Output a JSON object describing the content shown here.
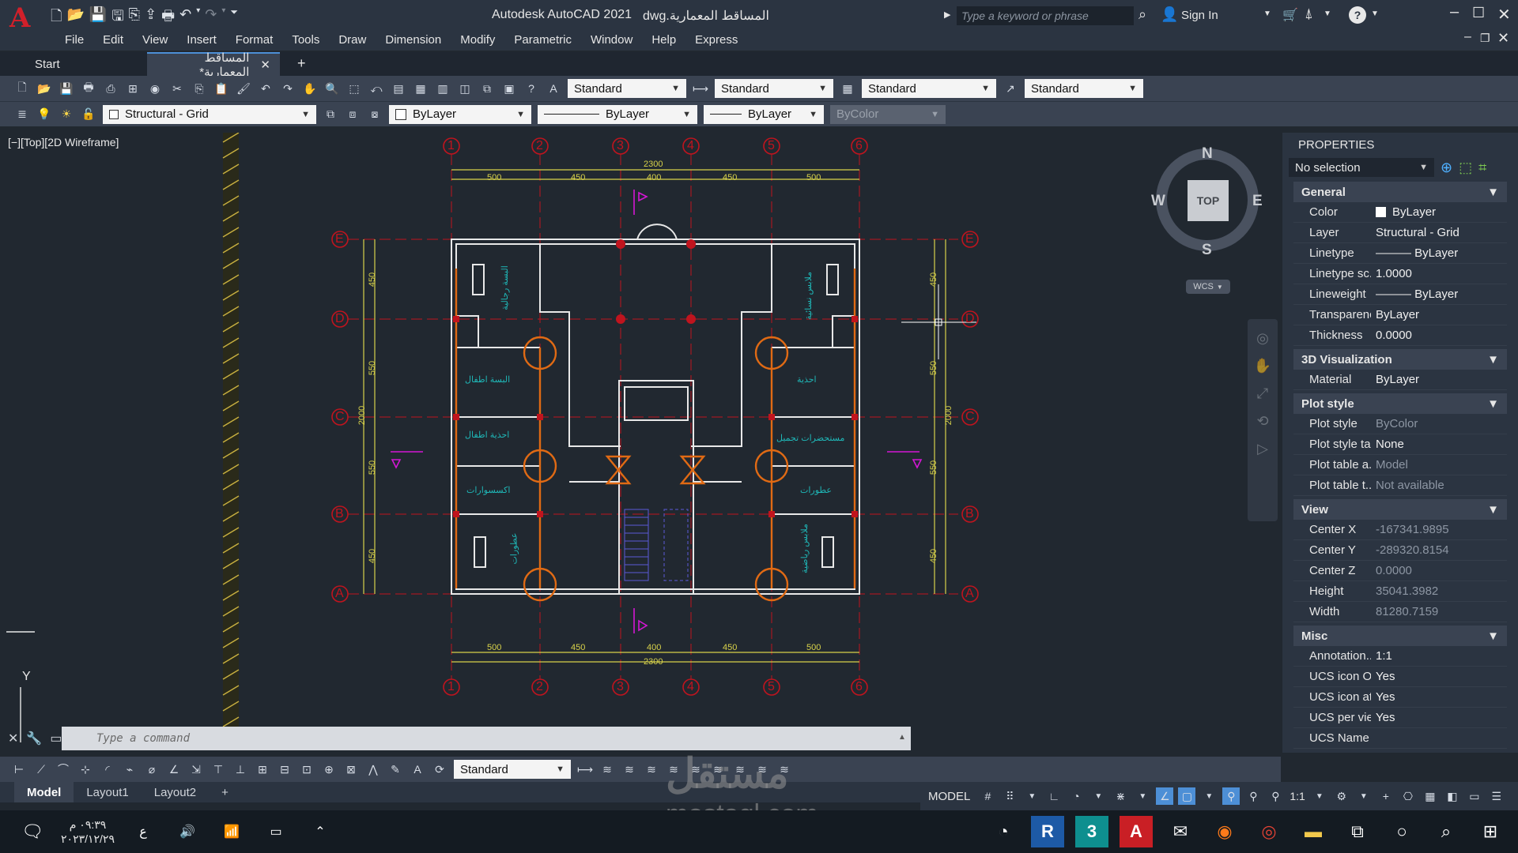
{
  "app": {
    "title": "Autodesk AutoCAD 2021",
    "file_name": "المساقط المعمارية.dwg",
    "search_placeholder": "Type a keyword or phrase",
    "sign_in": "Sign In"
  },
  "menu": [
    "File",
    "Edit",
    "View",
    "Insert",
    "Format",
    "Tools",
    "Draw",
    "Dimension",
    "Modify",
    "Parametric",
    "Window",
    "Help",
    "Express"
  ],
  "tabs": {
    "start": "Start",
    "document": "المساقط المعمارية*"
  },
  "styles": {
    "text_style": "Standard",
    "dim_style": "Standard",
    "table_style": "Standard",
    "mleader_style": "Standard",
    "annotation_scale_style": "Standard"
  },
  "layers": {
    "current": "Structural - Grid",
    "color": "ByLayer",
    "linetype": "ByLayer",
    "lineweight": "ByLayer",
    "plotstyle": "ByColor"
  },
  "viewport": {
    "label": "[−][Top][2D Wireframe]"
  },
  "viewcube": {
    "n": "N",
    "s": "S",
    "e": "E",
    "w": "W",
    "top": "TOP",
    "ucs": "WCS"
  },
  "drawing": {
    "grid_cols": [
      "1",
      "2",
      "3",
      "4",
      "5",
      "6"
    ],
    "grid_rows": [
      "E",
      "D",
      "C",
      "B",
      "A"
    ],
    "top_dims": [
      "500",
      "450",
      "400",
      "450",
      "500"
    ],
    "overall_dim": "2300",
    "side_dims": [
      "450",
      "550",
      "2000",
      "550",
      "450"
    ],
    "room_labels": [
      "البسة رجالية",
      "البسة اطفال",
      "احذية اطفال",
      "اكسسوارات",
      "عطورات",
      "ملابس نسائية",
      "احذية",
      "مستحضرات تجميل",
      "عطورات",
      "ملابس رياضية"
    ]
  },
  "properties": {
    "title": "PROPERTIES",
    "selection": "No selection",
    "sections": [
      {
        "name": "General",
        "rows": [
          {
            "k": "Color",
            "v": "ByLayer",
            "dim": false
          },
          {
            "k": "Layer",
            "v": "Structural - Grid",
            "dim": false
          },
          {
            "k": "Linetype",
            "v": "——— ByLayer",
            "dim": false
          },
          {
            "k": "Linetype sc...",
            "v": "1.0000",
            "dim": false
          },
          {
            "k": "Lineweight",
            "v": "——— ByLayer",
            "dim": false
          },
          {
            "k": "Transparency",
            "v": "ByLayer",
            "dim": false
          },
          {
            "k": "Thickness",
            "v": "0.0000",
            "dim": false
          }
        ]
      },
      {
        "name": "3D Visualization",
        "rows": [
          {
            "k": "Material",
            "v": "ByLayer",
            "dim": false
          }
        ]
      },
      {
        "name": "Plot style",
        "rows": [
          {
            "k": "Plot style",
            "v": "ByColor",
            "dim": true
          },
          {
            "k": "Plot style ta...",
            "v": "None",
            "dim": false
          },
          {
            "k": "Plot table a...",
            "v": "Model",
            "dim": true
          },
          {
            "k": "Plot table t...",
            "v": "Not available",
            "dim": true
          }
        ]
      },
      {
        "name": "View",
        "rows": [
          {
            "k": "Center X",
            "v": "-167341.9895",
            "dim": true
          },
          {
            "k": "Center Y",
            "v": "-289320.8154",
            "dim": true
          },
          {
            "k": "Center Z",
            "v": "0.0000",
            "dim": true
          },
          {
            "k": "Height",
            "v": "35041.3982",
            "dim": true
          },
          {
            "k": "Width",
            "v": "81280.7159",
            "dim": true
          }
        ]
      },
      {
        "name": "Misc",
        "rows": [
          {
            "k": "Annotation...",
            "v": "1:1",
            "dim": false
          },
          {
            "k": "UCS icon On",
            "v": "Yes",
            "dim": false
          },
          {
            "k": "UCS icon at...",
            "v": "Yes",
            "dim": false
          },
          {
            "k": "UCS per vie...",
            "v": "Yes",
            "dim": false
          },
          {
            "k": "UCS Name",
            "v": "",
            "dim": false
          }
        ]
      }
    ]
  },
  "command": {
    "placeholder": "Type a command"
  },
  "ucs_axis": "Y",
  "layouts": [
    "Model",
    "Layout1",
    "Layout2"
  ],
  "status": {
    "model": "MODEL",
    "scale": "1:1"
  },
  "taskbar": {
    "time": "٠٩:٣٩ م",
    "date": "٢٠٢٣/١٢/٢٩",
    "lang": "ع"
  },
  "watermark": {
    "site": "mostaql.com",
    "brand": "مستقل"
  },
  "colors": {
    "grid_red": "#c0141e",
    "dim_yellow": "#d8d24a",
    "wall_white": "#e8e8e8",
    "door_orange": "#e06a14",
    "text_cyan": "#1fb7b7",
    "magenta": "#d416d4"
  }
}
